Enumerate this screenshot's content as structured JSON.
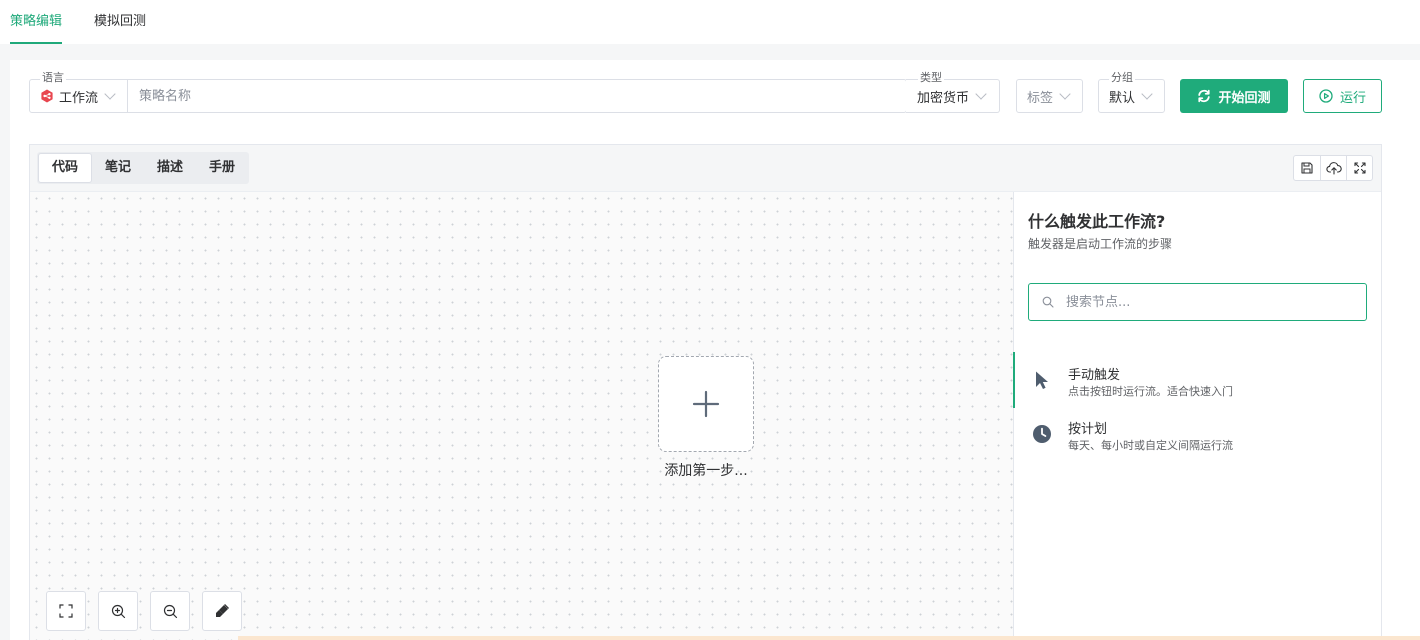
{
  "top_tabs": [
    {
      "label": "策略编辑",
      "active": true
    },
    {
      "label": "模拟回测",
      "active": false
    }
  ],
  "form": {
    "language": {
      "label": "语言",
      "value": "工作流"
    },
    "name": {
      "placeholder": "策略名称",
      "value": ""
    },
    "type": {
      "label": "类型",
      "value": "加密货币"
    },
    "tag": {
      "placeholder": "标签"
    },
    "group": {
      "label": "分组",
      "value": "默认"
    },
    "start_backtest_label": "开始回测",
    "run_label": "运行"
  },
  "editor": {
    "tabs": [
      {
        "label": "代码",
        "active": true
      },
      {
        "label": "笔记",
        "active": false
      },
      {
        "label": "描述",
        "active": false
      },
      {
        "label": "手册",
        "active": false
      }
    ],
    "toolbar_icons": [
      "save-icon",
      "cloud-upload-icon",
      "fullscreen-icon"
    ]
  },
  "canvas": {
    "add_step_label": "添加第一步...",
    "controls": [
      "fit-view-icon",
      "zoom-in-icon",
      "zoom-out-icon",
      "clear-icon"
    ]
  },
  "side": {
    "title": "什么触发此工作流?",
    "subtitle": "触发器是启动工作流的步骤",
    "search_placeholder": "搜索节点...",
    "triggers": [
      {
        "icon": "cursor-icon",
        "name": "手动触发",
        "desc": "点击按钮时运行流。适合快速入门",
        "active": true
      },
      {
        "icon": "clock-icon",
        "name": "按计划",
        "desc": "每天、每小时或自定义间隔运行流",
        "active": false
      }
    ]
  },
  "colors": {
    "accent": "#1fab7b",
    "text": "#303133",
    "muted": "#606266"
  }
}
